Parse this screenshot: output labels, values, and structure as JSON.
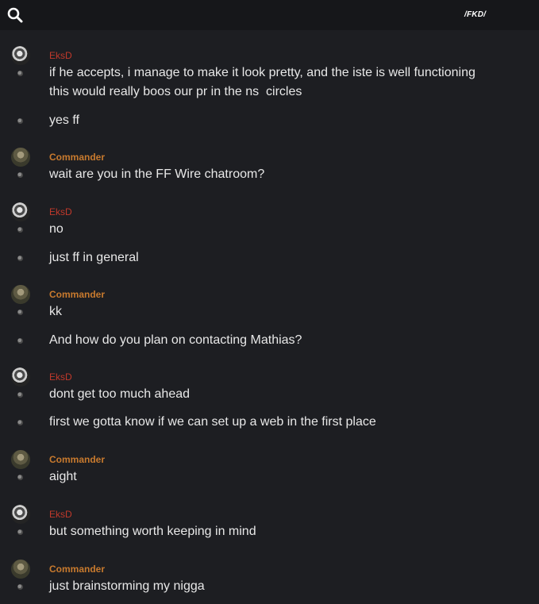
{
  "header": {
    "channel_name": "/FKD/",
    "search_icon": "search-icon"
  },
  "colors": {
    "background": "#1d1e22",
    "topbar": "#16171a",
    "eksd_name": "#c0392b",
    "commander_name": "#c87a2e",
    "message_text": "#e8e8e8"
  },
  "messages": [
    {
      "author": "EksD",
      "text_line1": "if he accepts, i manage to make it look pretty, and the iste is well functioning",
      "text_line2": "this would really boos our pr in the ns  circles"
    },
    {
      "text": "yes ff"
    },
    {
      "author": "Commander",
      "text": "wait are you in the FF Wire chatroom?"
    },
    {
      "author": "EksD",
      "text": "no"
    },
    {
      "text": "just ff in general"
    },
    {
      "author": "Commander",
      "text": "kk"
    },
    {
      "text": "And how do you plan on contacting Mathias?"
    },
    {
      "author": "EksD",
      "text": "dont get too much ahead"
    },
    {
      "text": "first we gotta know if we can set up a web in the first place"
    },
    {
      "author": "Commander",
      "text": "aight"
    },
    {
      "author": "EksD",
      "text": "but something worth keeping in mind"
    },
    {
      "author": "Commander",
      "text": "just brainstorming my nigga"
    }
  ]
}
